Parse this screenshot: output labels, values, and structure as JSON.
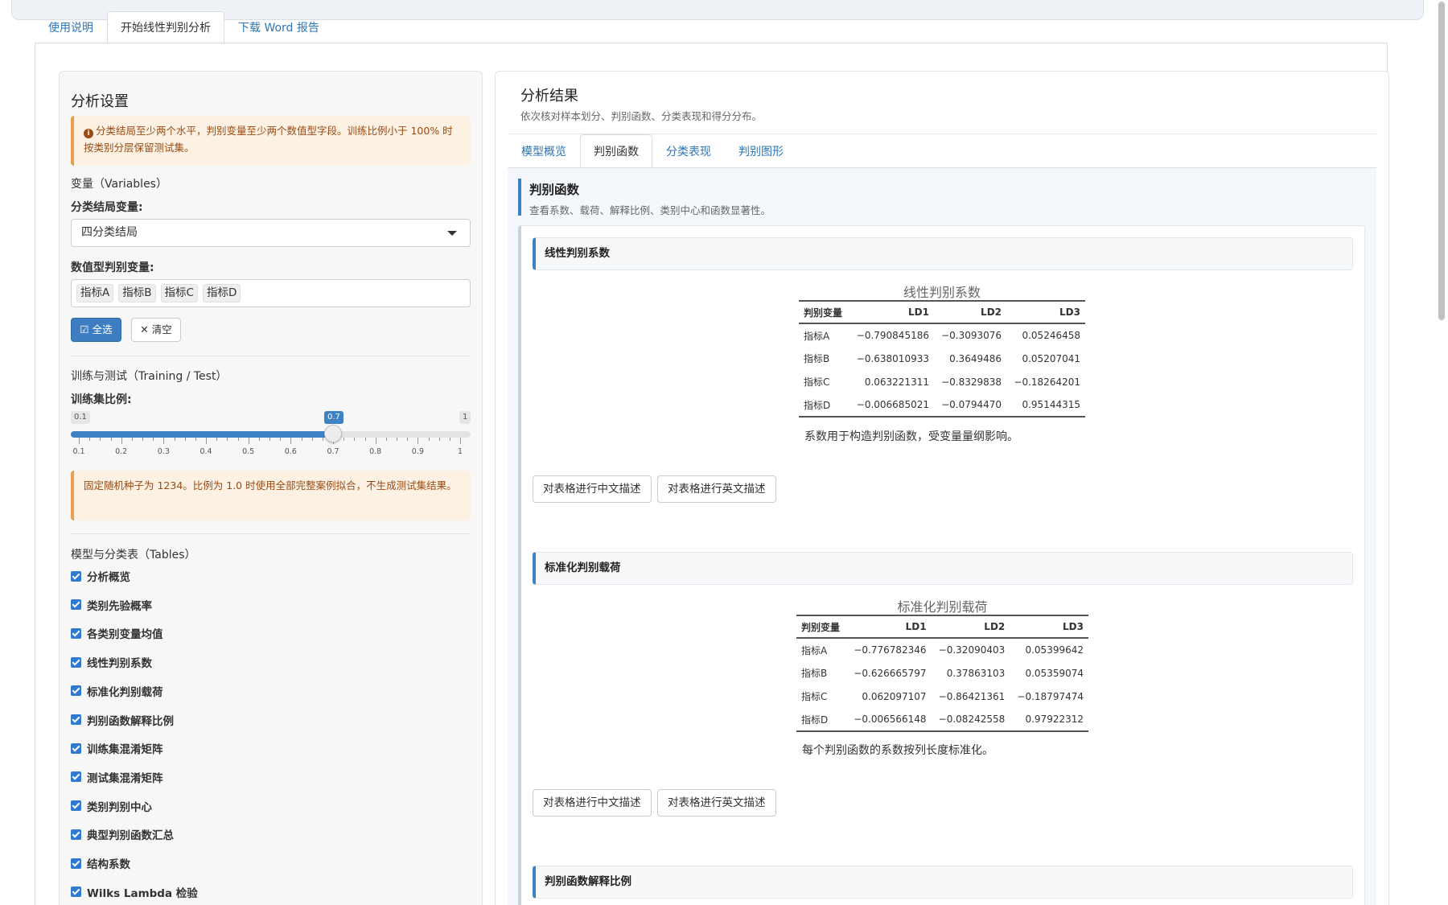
{
  "main_tabs": [
    "使用说明",
    "开始线性判别分析",
    "下载 Word 报告"
  ],
  "left": {
    "title": "分析设置",
    "warning1": "分类结局至少两个水平，判别变量至少两个数值型字段。训练比例小于 100% 时按类别分层保留测试集。",
    "variables_heading": "变量（Variables）",
    "outcome_label": "分类结局变量:",
    "outcome_value": "四分类结局",
    "predictors_label": "数值型判别变量:",
    "predictor_tags": [
      "指标A",
      "指标B",
      "指标C",
      "指标D"
    ],
    "select_all": "全选",
    "clear": "清空",
    "train_heading": "训练与测试（Training / Test）",
    "train_ratio_label": "训练集比例:",
    "slider": {
      "min": "0.1",
      "max": "1",
      "value": "0.7",
      "value_num": 0.7,
      "ticks": [
        "0.1",
        "0.2",
        "0.3",
        "0.4",
        "0.5",
        "0.6",
        "0.7",
        "0.8",
        "0.9",
        "1"
      ]
    },
    "warning2": "固定随机种子为 1234。比例为 1.0 时使用全部完整案例拟合，不生成测试集结果。",
    "tables_heading": "模型与分类表（Tables）",
    "checkboxes": [
      "分析概览",
      "类别先验概率",
      "各类别变量均值",
      "线性判别系数",
      "标准化判别载荷",
      "判别函数解释比例",
      "训练集混淆矩阵",
      "测试集混淆矩阵",
      "类别判别中心",
      "典型判别函数汇总",
      "结构系数",
      "Wilks Lambda 检验"
    ]
  },
  "right": {
    "title": "分析结果",
    "subtitle": "依次核对样本划分、判别函数、分类表现和得分分布。",
    "tabs": [
      "模型概览",
      "判别函数",
      "分类表现",
      "判别图形"
    ],
    "section_title": "判别函数",
    "section_sub": "查看系数、载荷、解释比例、类别中心和函数显著性。",
    "cards": [
      {
        "head": "线性判别系数",
        "caption": "线性判别系数",
        "columns": [
          "判别变量",
          "LD1",
          "LD2",
          "LD3"
        ],
        "rows": [
          [
            "指标A",
            "−0.790845186",
            "−0.3093076",
            "0.05246458"
          ],
          [
            "指标B",
            "−0.638010933",
            "0.3649486",
            "0.05207041"
          ],
          [
            "指标C",
            "0.063221311",
            "−0.8329838",
            "−0.18264201"
          ],
          [
            "指标D",
            "−0.006685021",
            "−0.0794470",
            "0.95144315"
          ]
        ],
        "note": "系数用于构造判别函数，受变量量纲影响。",
        "btn_cn": "对表格进行中文描述",
        "btn_en": "对表格进行英文描述"
      },
      {
        "head": "标准化判别载荷",
        "caption": "标准化判别载荷",
        "columns": [
          "判别变量",
          "LD1",
          "LD2",
          "LD3"
        ],
        "rows": [
          [
            "指标A",
            "−0.776782346",
            "−0.32090403",
            "0.05399642"
          ],
          [
            "指标B",
            "−0.626665797",
            "0.37863103",
            "0.05359074"
          ],
          [
            "指标C",
            "0.062097107",
            "−0.86421361",
            "−0.18797474"
          ],
          [
            "指标D",
            "−0.006566148",
            "−0.08242558",
            "0.97922312"
          ]
        ],
        "note": "每个判别函数的系数按列长度标准化。",
        "btn_cn": "对表格进行中文描述",
        "btn_en": "对表格进行英文描述"
      },
      {
        "head": "判别函数解释比例"
      }
    ]
  }
}
